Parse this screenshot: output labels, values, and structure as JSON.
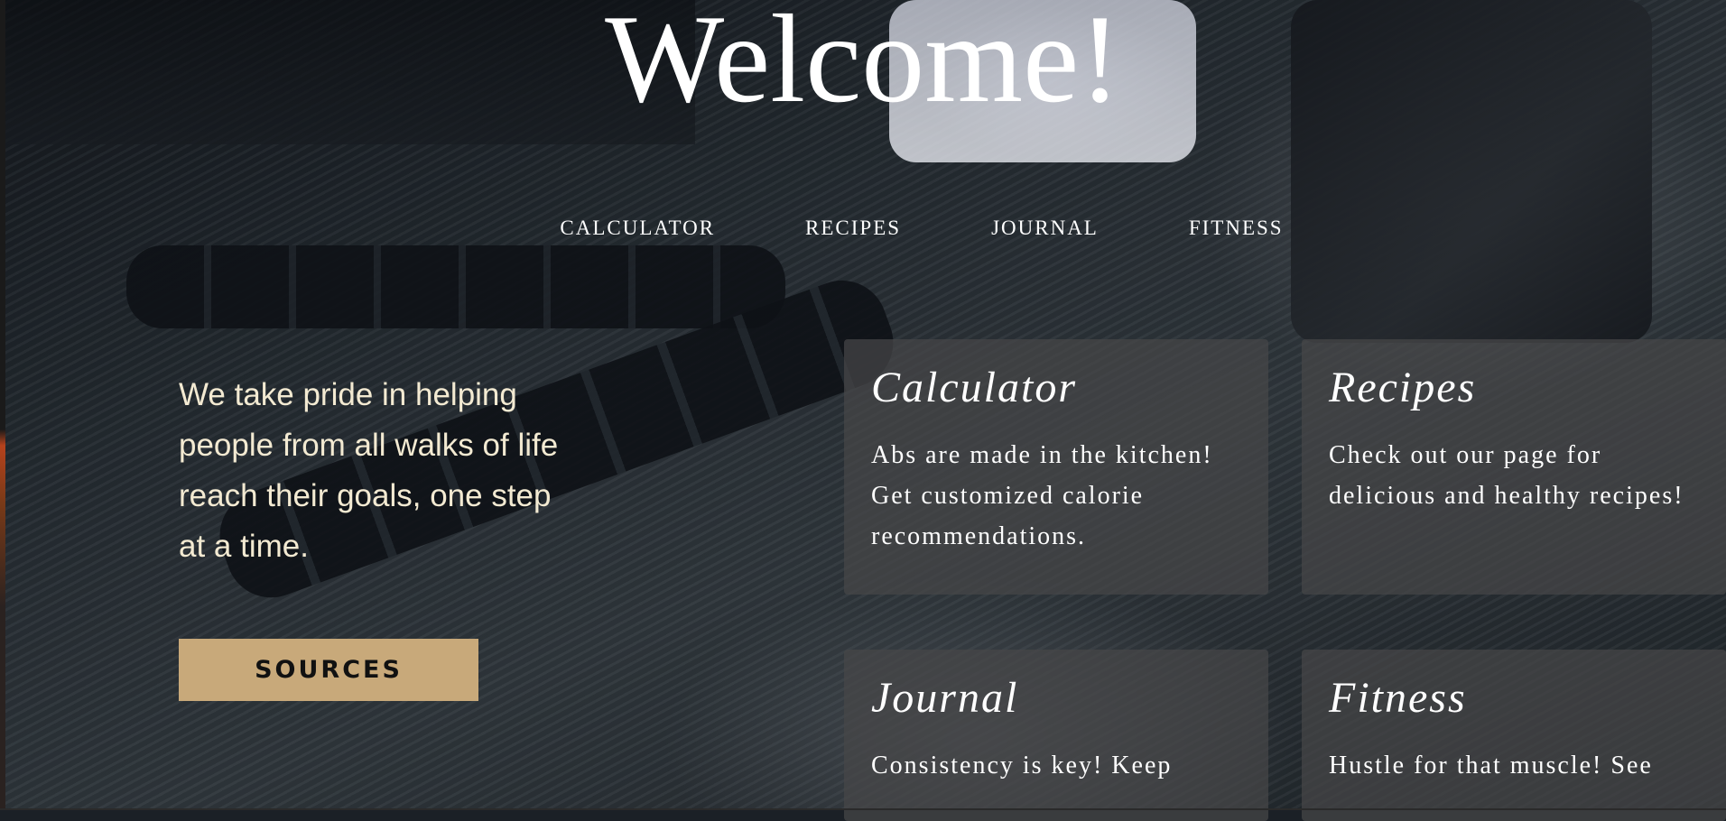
{
  "header": {
    "title": "Welcome!"
  },
  "nav": {
    "items": [
      {
        "label": "CALCULATOR"
      },
      {
        "label": "RECIPES"
      },
      {
        "label": "JOURNAL"
      },
      {
        "label": "FITNESS"
      }
    ]
  },
  "hero": {
    "tagline": "We take pride in helping people from all walks of life reach their goals, one step at a time.",
    "button_label": "SOURCES"
  },
  "cards": [
    {
      "title": "Calculator",
      "text": "Abs are made in the kitchen! Get customized calorie recommendations."
    },
    {
      "title": "Recipes",
      "text": "Check out our page for delicious and healthy recipes!"
    },
    {
      "title": "Journal",
      "text": "Consistency is key! Keep"
    },
    {
      "title": "Fitness",
      "text": "Hustle for that muscle! See"
    }
  ],
  "colors": {
    "accent_button": "#c8a97a",
    "tagline_text": "#f3ead2",
    "card_bg": "#464648"
  }
}
